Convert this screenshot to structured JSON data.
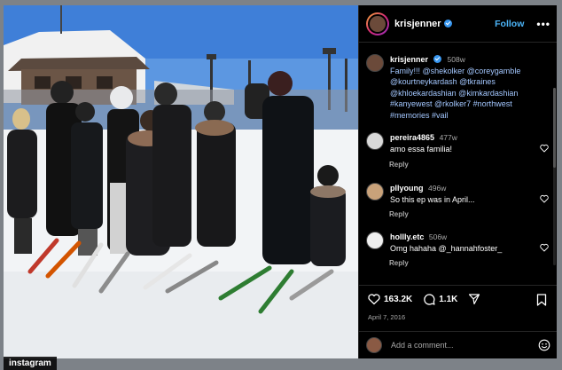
{
  "post": {
    "username": "krisjenner",
    "follow_label": "Follow",
    "more_label": "•••"
  },
  "caption": {
    "username": "krisjenner",
    "age": "508w",
    "text_lines": [
      "Family!!! @shekolker @coreygamble",
      "@kourtneykardash @tkraines",
      "@khloekardashian @kimkardashian",
      "#kanyewest @rkolker7 #northwest",
      "#memories #vail"
    ]
  },
  "comments": [
    {
      "username": "pereira4865",
      "age": "477w",
      "text": "amo essa familia!",
      "reply": "Reply",
      "avatar_color": "#d9d9d9"
    },
    {
      "username": "pllyoung",
      "age": "496w",
      "text": "So this ep was in April...",
      "reply": "Reply",
      "avatar_color": "#c9a27a"
    },
    {
      "username": "hollly.etc",
      "age": "506w",
      "text": "Omg hahaha @_hannahfoster_",
      "reply": "Reply",
      "avatar_color": "#efefef"
    }
  ],
  "stats": {
    "likes": "163.2K",
    "comments": "1.1K",
    "date": "April 7, 2016"
  },
  "add_comment": {
    "placeholder": "Add a comment..."
  },
  "watermark": "instagram",
  "colors": {
    "link": "#4cb5f9",
    "tag": "#a3c7ff",
    "muted": "#a8a8a8",
    "verified": "#3897f0"
  }
}
